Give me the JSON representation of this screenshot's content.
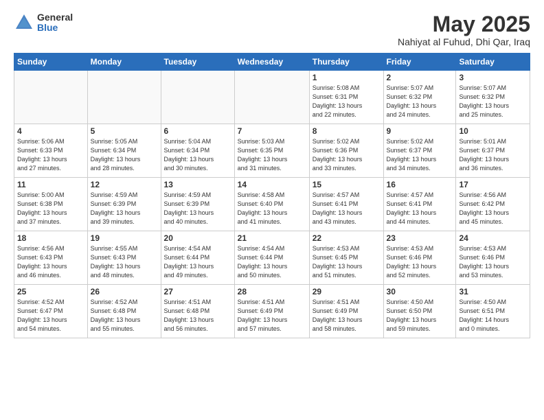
{
  "logo": {
    "general": "General",
    "blue": "Blue"
  },
  "title": "May 2025",
  "subtitle": "Nahiyat al Fuhud, Dhi Qar, Iraq",
  "days_header": [
    "Sunday",
    "Monday",
    "Tuesday",
    "Wednesday",
    "Thursday",
    "Friday",
    "Saturday"
  ],
  "weeks": [
    [
      {
        "num": "",
        "info": ""
      },
      {
        "num": "",
        "info": ""
      },
      {
        "num": "",
        "info": ""
      },
      {
        "num": "",
        "info": ""
      },
      {
        "num": "1",
        "info": "Sunrise: 5:08 AM\nSunset: 6:31 PM\nDaylight: 13 hours\nand 22 minutes."
      },
      {
        "num": "2",
        "info": "Sunrise: 5:07 AM\nSunset: 6:32 PM\nDaylight: 13 hours\nand 24 minutes."
      },
      {
        "num": "3",
        "info": "Sunrise: 5:07 AM\nSunset: 6:32 PM\nDaylight: 13 hours\nand 25 minutes."
      }
    ],
    [
      {
        "num": "4",
        "info": "Sunrise: 5:06 AM\nSunset: 6:33 PM\nDaylight: 13 hours\nand 27 minutes."
      },
      {
        "num": "5",
        "info": "Sunrise: 5:05 AM\nSunset: 6:34 PM\nDaylight: 13 hours\nand 28 minutes."
      },
      {
        "num": "6",
        "info": "Sunrise: 5:04 AM\nSunset: 6:34 PM\nDaylight: 13 hours\nand 30 minutes."
      },
      {
        "num": "7",
        "info": "Sunrise: 5:03 AM\nSunset: 6:35 PM\nDaylight: 13 hours\nand 31 minutes."
      },
      {
        "num": "8",
        "info": "Sunrise: 5:02 AM\nSunset: 6:36 PM\nDaylight: 13 hours\nand 33 minutes."
      },
      {
        "num": "9",
        "info": "Sunrise: 5:02 AM\nSunset: 6:37 PM\nDaylight: 13 hours\nand 34 minutes."
      },
      {
        "num": "10",
        "info": "Sunrise: 5:01 AM\nSunset: 6:37 PM\nDaylight: 13 hours\nand 36 minutes."
      }
    ],
    [
      {
        "num": "11",
        "info": "Sunrise: 5:00 AM\nSunset: 6:38 PM\nDaylight: 13 hours\nand 37 minutes."
      },
      {
        "num": "12",
        "info": "Sunrise: 4:59 AM\nSunset: 6:39 PM\nDaylight: 13 hours\nand 39 minutes."
      },
      {
        "num": "13",
        "info": "Sunrise: 4:59 AM\nSunset: 6:39 PM\nDaylight: 13 hours\nand 40 minutes."
      },
      {
        "num": "14",
        "info": "Sunrise: 4:58 AM\nSunset: 6:40 PM\nDaylight: 13 hours\nand 41 minutes."
      },
      {
        "num": "15",
        "info": "Sunrise: 4:57 AM\nSunset: 6:41 PM\nDaylight: 13 hours\nand 43 minutes."
      },
      {
        "num": "16",
        "info": "Sunrise: 4:57 AM\nSunset: 6:41 PM\nDaylight: 13 hours\nand 44 minutes."
      },
      {
        "num": "17",
        "info": "Sunrise: 4:56 AM\nSunset: 6:42 PM\nDaylight: 13 hours\nand 45 minutes."
      }
    ],
    [
      {
        "num": "18",
        "info": "Sunrise: 4:56 AM\nSunset: 6:43 PM\nDaylight: 13 hours\nand 46 minutes."
      },
      {
        "num": "19",
        "info": "Sunrise: 4:55 AM\nSunset: 6:43 PM\nDaylight: 13 hours\nand 48 minutes."
      },
      {
        "num": "20",
        "info": "Sunrise: 4:54 AM\nSunset: 6:44 PM\nDaylight: 13 hours\nand 49 minutes."
      },
      {
        "num": "21",
        "info": "Sunrise: 4:54 AM\nSunset: 6:44 PM\nDaylight: 13 hours\nand 50 minutes."
      },
      {
        "num": "22",
        "info": "Sunrise: 4:53 AM\nSunset: 6:45 PM\nDaylight: 13 hours\nand 51 minutes."
      },
      {
        "num": "23",
        "info": "Sunrise: 4:53 AM\nSunset: 6:46 PM\nDaylight: 13 hours\nand 52 minutes."
      },
      {
        "num": "24",
        "info": "Sunrise: 4:53 AM\nSunset: 6:46 PM\nDaylight: 13 hours\nand 53 minutes."
      }
    ],
    [
      {
        "num": "25",
        "info": "Sunrise: 4:52 AM\nSunset: 6:47 PM\nDaylight: 13 hours\nand 54 minutes."
      },
      {
        "num": "26",
        "info": "Sunrise: 4:52 AM\nSunset: 6:48 PM\nDaylight: 13 hours\nand 55 minutes."
      },
      {
        "num": "27",
        "info": "Sunrise: 4:51 AM\nSunset: 6:48 PM\nDaylight: 13 hours\nand 56 minutes."
      },
      {
        "num": "28",
        "info": "Sunrise: 4:51 AM\nSunset: 6:49 PM\nDaylight: 13 hours\nand 57 minutes."
      },
      {
        "num": "29",
        "info": "Sunrise: 4:51 AM\nSunset: 6:49 PM\nDaylight: 13 hours\nand 58 minutes."
      },
      {
        "num": "30",
        "info": "Sunrise: 4:50 AM\nSunset: 6:50 PM\nDaylight: 13 hours\nand 59 minutes."
      },
      {
        "num": "31",
        "info": "Sunrise: 4:50 AM\nSunset: 6:51 PM\nDaylight: 14 hours\nand 0 minutes."
      }
    ]
  ]
}
